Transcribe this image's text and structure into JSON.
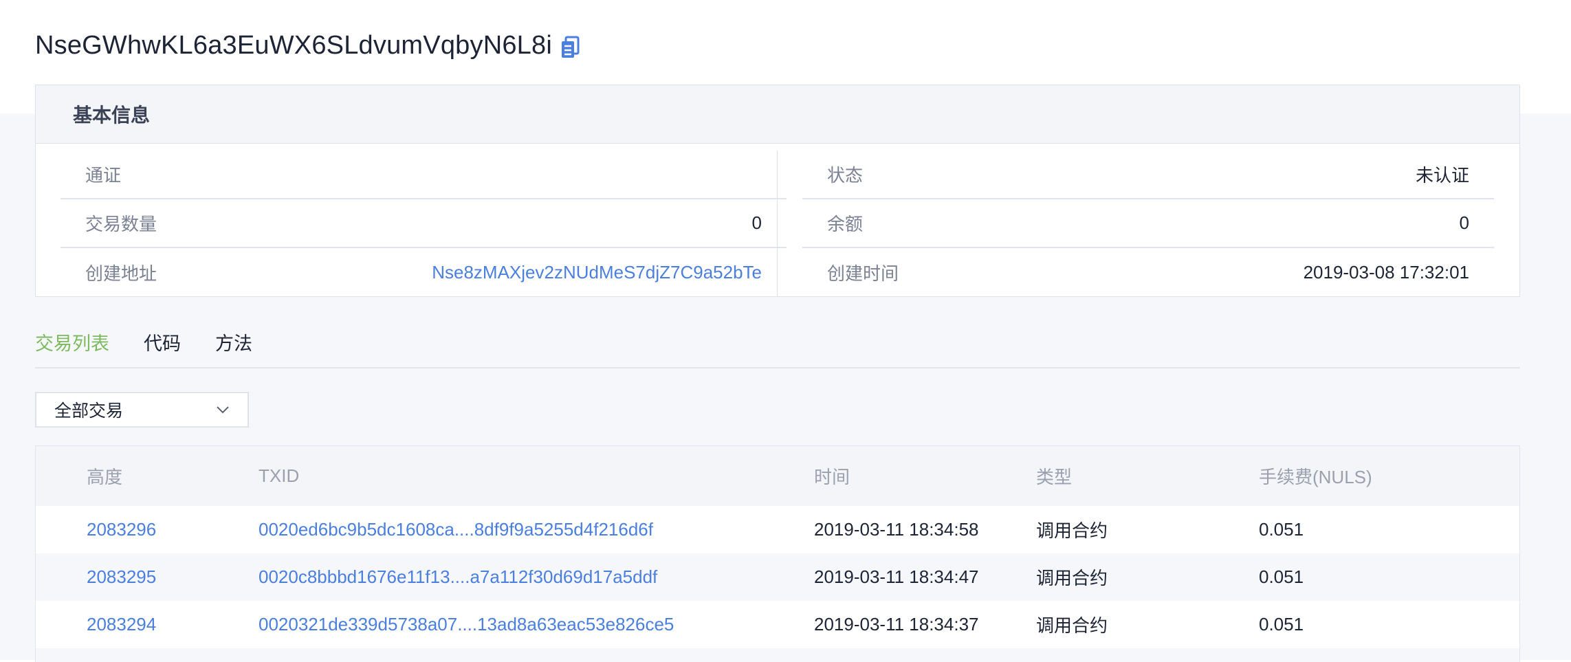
{
  "contract": {
    "address": "NseGWhwKL6a3EuWX6SLdvumVqbyN6L8i"
  },
  "icons": {
    "copy": "copy-icon",
    "dropdown": "chevron-down-icon"
  },
  "colors": {
    "link": "#4a7fe0",
    "tab_active": "#7dba5f"
  },
  "info": {
    "heading": "基本信息",
    "left": [
      {
        "label": "通证",
        "value": ""
      },
      {
        "label": "交易数量",
        "value": "0"
      },
      {
        "label": "创建地址",
        "value": "Nse8zMAXjev2zNUdMeS7djZ7C9a52bTe"
      }
    ],
    "right": [
      {
        "label": "状态",
        "value": "未认证"
      },
      {
        "label": "余额",
        "value": "0"
      },
      {
        "label": "创建时间",
        "value": "2019-03-08 17:32:01"
      }
    ]
  },
  "tabs": [
    {
      "label": "交易列表",
      "active": true
    },
    {
      "label": "代码",
      "active": false
    },
    {
      "label": "方法",
      "active": false
    }
  ],
  "filter": {
    "selected": "全部交易"
  },
  "table": {
    "headers": [
      "高度",
      "TXID",
      "时间",
      "类型",
      "手续费(NULS)"
    ],
    "rows": [
      {
        "height": "2083296",
        "txid": "0020ed6bc9b5dc1608ca....8df9f9a5255d4f216d6f",
        "time": "2019-03-11 18:34:58",
        "type": "调用合约",
        "fee": "0.051"
      },
      {
        "height": "2083295",
        "txid": "0020c8bbbd1676e11f13....a7a112f30d69d17a5ddf",
        "time": "2019-03-11 18:34:47",
        "type": "调用合约",
        "fee": "0.051"
      },
      {
        "height": "2083294",
        "txid": "0020321de339d5738a07....13ad8a63eac53e826ce5",
        "time": "2019-03-11 18:34:37",
        "type": "调用合约",
        "fee": "0.051"
      }
    ]
  }
}
